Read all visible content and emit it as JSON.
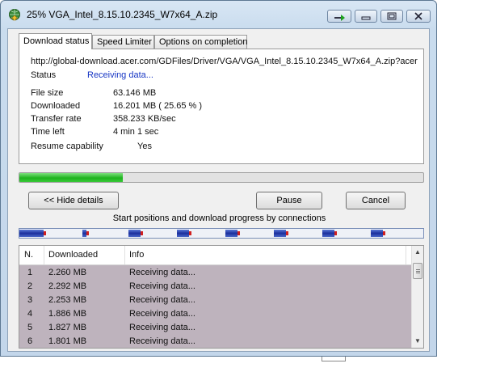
{
  "window": {
    "title": "25% VGA_Intel_8.15.10.2345_W7x64_A.zip",
    "icon": "download-globe-icon"
  },
  "tabs": [
    {
      "label": "Download status"
    },
    {
      "label": "Speed Limiter"
    },
    {
      "label": "Options on completion"
    }
  ],
  "details": {
    "url": "http://global-download.acer.com/GDFiles/Driver/VGA/VGA_Intel_8.15.10.2345_W7x64_A.zip?acer",
    "status_label": "Status",
    "status_value": "Receiving data...",
    "file_size_label": "File size",
    "file_size_value": "63.146  MB",
    "downloaded_label": "Downloaded",
    "downloaded_value": "16.201  MB  ( 25.65 % )",
    "transfer_rate_label": "Transfer rate",
    "transfer_rate_value": "358.233  KB/sec",
    "time_left_label": "Time left",
    "time_left_value": "4 min 1 sec",
    "resume_label": "Resume capability",
    "resume_value": "Yes"
  },
  "progress": {
    "percent": 25.65,
    "color": "#1fb31f"
  },
  "buttons": {
    "hide_details": "<< Hide details",
    "pause": "Pause",
    "cancel": "Cancel"
  },
  "connections": {
    "caption": "Start positions and download progress by connections",
    "segments_fraction": [
      [
        0.0,
        0.06
      ],
      [
        0.155,
        0.165
      ],
      [
        0.27,
        0.3
      ],
      [
        0.39,
        0.42
      ],
      [
        0.51,
        0.54
      ],
      [
        0.63,
        0.66
      ],
      [
        0.75,
        0.78
      ],
      [
        0.87,
        0.9
      ]
    ]
  },
  "list": {
    "columns": [
      "N.",
      "Downloaded",
      "Info"
    ],
    "rows": [
      {
        "n": "1",
        "downloaded": "2.260  MB",
        "info": "Receiving data..."
      },
      {
        "n": "2",
        "downloaded": "2.292  MB",
        "info": "Receiving data..."
      },
      {
        "n": "3",
        "downloaded": "2.253  MB",
        "info": "Receiving data..."
      },
      {
        "n": "4",
        "downloaded": "1.886  MB",
        "info": "Receiving data..."
      },
      {
        "n": "5",
        "downloaded": "1.827  MB",
        "info": "Receiving data..."
      },
      {
        "n": "6",
        "downloaded": "1.801  MB",
        "info": "Receiving data..."
      }
    ]
  }
}
